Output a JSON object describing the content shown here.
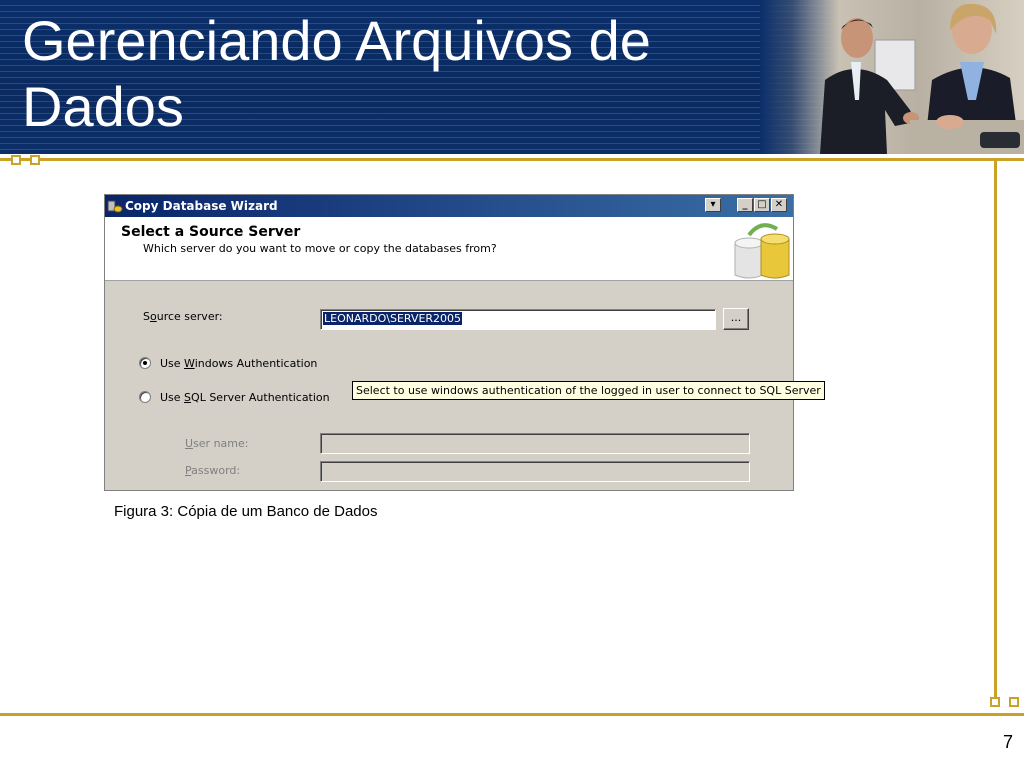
{
  "slide": {
    "title": "Gerenciando Arquivos de Dados",
    "caption": "Figura 3: Cópia de um Banco de Dados",
    "page_number": "7",
    "colors": {
      "banner": "#0b2f6b",
      "accent": "#c9a227"
    }
  },
  "dialog": {
    "window_title": "Copy Database Wizard",
    "header_title": "Select a Source Server",
    "header_subtitle": "Which server do you want to move or copy the databases from?",
    "source_server": {
      "label_pre": "S",
      "label_u": "o",
      "label_post": "urce server:",
      "value": "LEONARDO\\SERVER2005",
      "browse_label": "..."
    },
    "windows_auth": {
      "label_pre": "Use ",
      "label_u": "W",
      "label_post": "indows Authentication",
      "selected": true
    },
    "sql_auth": {
      "label_pre": "Use ",
      "label_u": "S",
      "label_post": "QL Server Authentication",
      "selected": false
    },
    "user_name": {
      "label_u": "U",
      "label_post": "ser name:",
      "value": ""
    },
    "password": {
      "label_u": "P",
      "label_post": "assword:",
      "value": ""
    },
    "tooltip": "Select to use windows authentication of the logged in user to connect to SQL Server"
  }
}
